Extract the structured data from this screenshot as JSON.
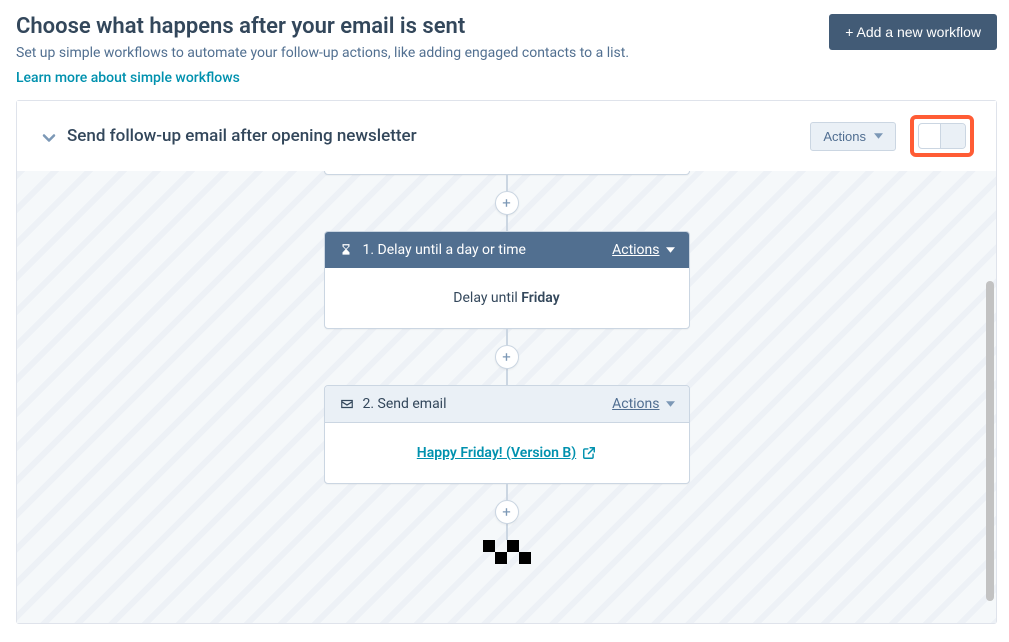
{
  "header": {
    "title": "Choose what happens after your email is sent",
    "subtitle": "Set up simple workflows to automate your follow-up actions, like adding engaged contacts to a list.",
    "learn_more": "Learn more about simple workflows",
    "add_button": "+ Add a new workflow"
  },
  "panel": {
    "title": "Send follow-up email after opening newsletter",
    "actions_label": "Actions"
  },
  "flow": {
    "delay": {
      "title": "1. Delay until a day or time",
      "actions": "Actions",
      "body_prefix": "Delay until ",
      "body_value": "Friday"
    },
    "email": {
      "title": "2. Send email",
      "actions": "Actions",
      "link": "Happy Friday! (Version B)"
    }
  }
}
